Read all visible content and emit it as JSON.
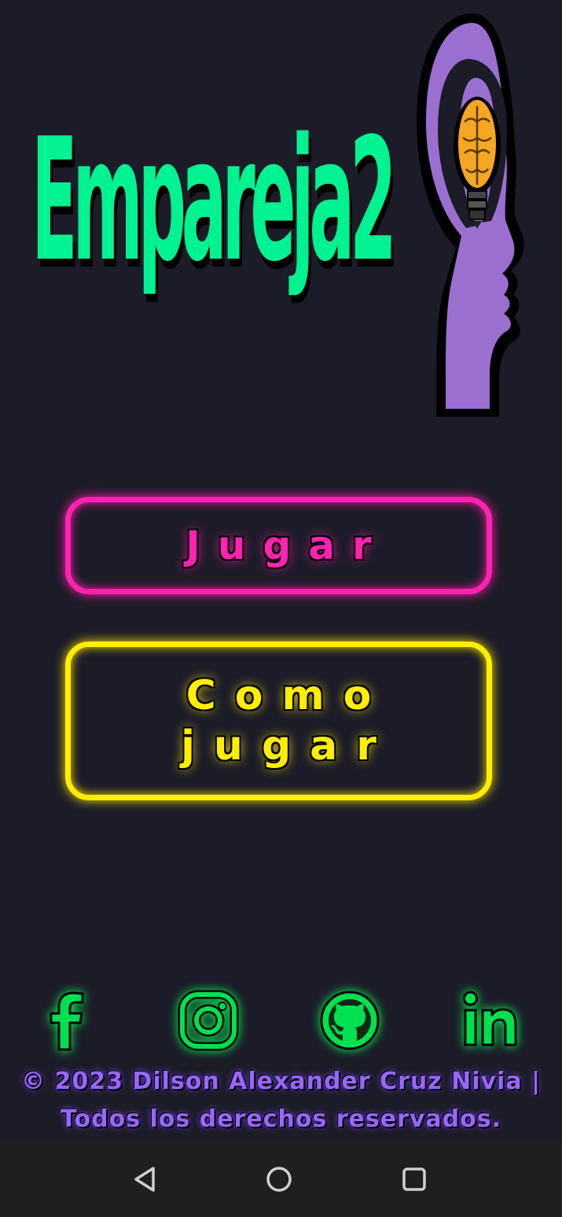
{
  "app": {
    "title": "Empareja2"
  },
  "buttons": {
    "play_label": "Jugar",
    "how_to_play_line1": "Como",
    "how_to_play_line2": "jugar"
  },
  "social": {
    "items": [
      {
        "name": "facebook",
        "icon": "facebook-icon"
      },
      {
        "name": "instagram",
        "icon": "instagram-icon"
      },
      {
        "name": "github",
        "icon": "github-icon"
      },
      {
        "name": "linkedin",
        "icon": "linkedin-icon"
      }
    ]
  },
  "footer": {
    "line1": "© 2023 Dilson Alexander Cruz Nivia |",
    "line2": "Todos los derechos reservados."
  },
  "colors": {
    "background": "#1c1c28",
    "title_green": "#00f291",
    "play_pink": "#ff22b3",
    "how_yellow": "#ffee00",
    "social_green": "#00ff55",
    "footer_purple": "#9966ff",
    "head_purple": "#9b6fd0",
    "bulb_orange": "#f5a623",
    "navbar": "#1f1f1f"
  },
  "navbar": {
    "items": [
      {
        "name": "back",
        "icon": "back-triangle-icon"
      },
      {
        "name": "home",
        "icon": "home-circle-icon"
      },
      {
        "name": "recents",
        "icon": "recents-square-icon"
      }
    ]
  }
}
